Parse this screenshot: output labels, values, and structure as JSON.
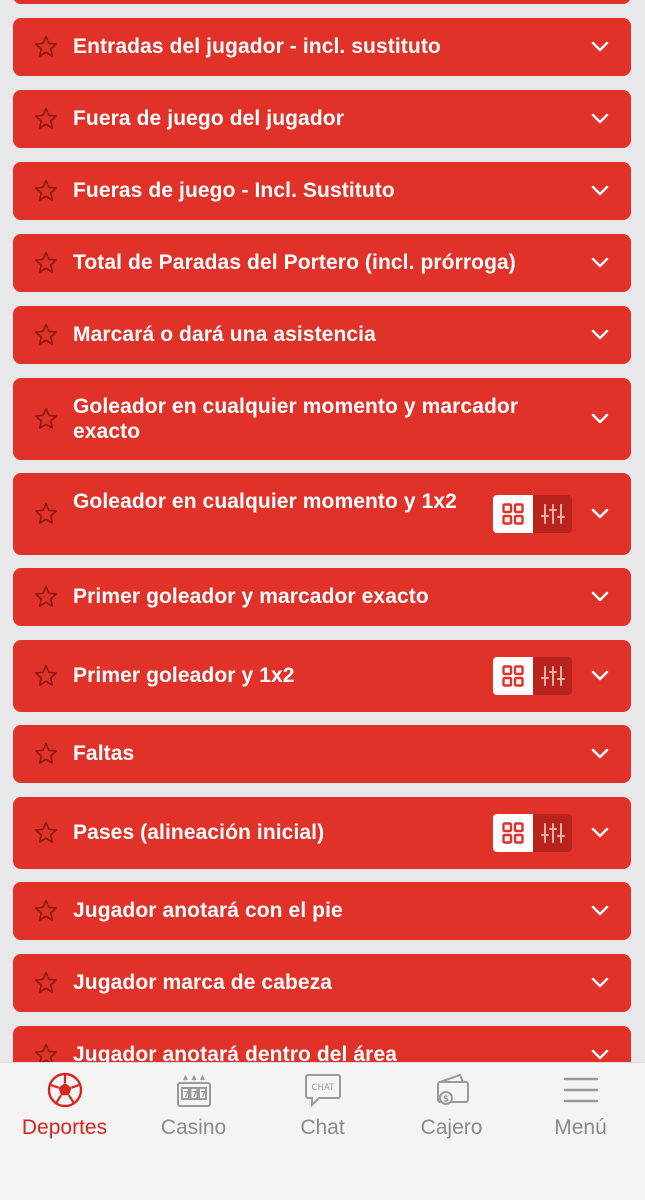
{
  "markets": [
    {
      "title": ""
    },
    {
      "title": "Entradas del jugador - incl. sustituto"
    },
    {
      "title": "Fuera de juego del jugador"
    },
    {
      "title": "Fueras de juego - Incl. Sustituto"
    },
    {
      "title": "Total de Paradas del Portero (incl. prórroga)"
    },
    {
      "title": "Marcará o dará una asistencia"
    },
    {
      "title": "Goleador en cualquier momento y marcador exacto"
    },
    {
      "title": "Goleador en cualquier momento y 1x2"
    },
    {
      "title": "Primer goleador y marcador exacto"
    },
    {
      "title": "Primer goleador y 1x2"
    },
    {
      "title": "Faltas"
    },
    {
      "title": "Pases (alineación inicial)"
    },
    {
      "title": "Jugador anotará con el pie"
    },
    {
      "title": "Jugador marca de cabeza"
    },
    {
      "title": "Jugador anotará dentro del área"
    }
  ],
  "nav": {
    "items": [
      {
        "label": "Deportes",
        "icon": "soccer-ball-icon",
        "active": true
      },
      {
        "label": "Casino",
        "icon": "slot-machine-icon",
        "active": false
      },
      {
        "label": "Chat",
        "icon": "chat-icon",
        "active": false
      },
      {
        "label": "Cajero",
        "icon": "wallet-icon",
        "active": false
      },
      {
        "label": "Menú",
        "icon": "hamburger-menu-icon",
        "active": false
      }
    ],
    "chat_icon_text": "CHAT"
  },
  "colors": {
    "market_bg": "#e1322a",
    "toggle_dark": "#b8231c",
    "active_nav": "#d7261f",
    "inactive_nav": "#8a8a8a",
    "page_bg": "#e8e8ea"
  }
}
